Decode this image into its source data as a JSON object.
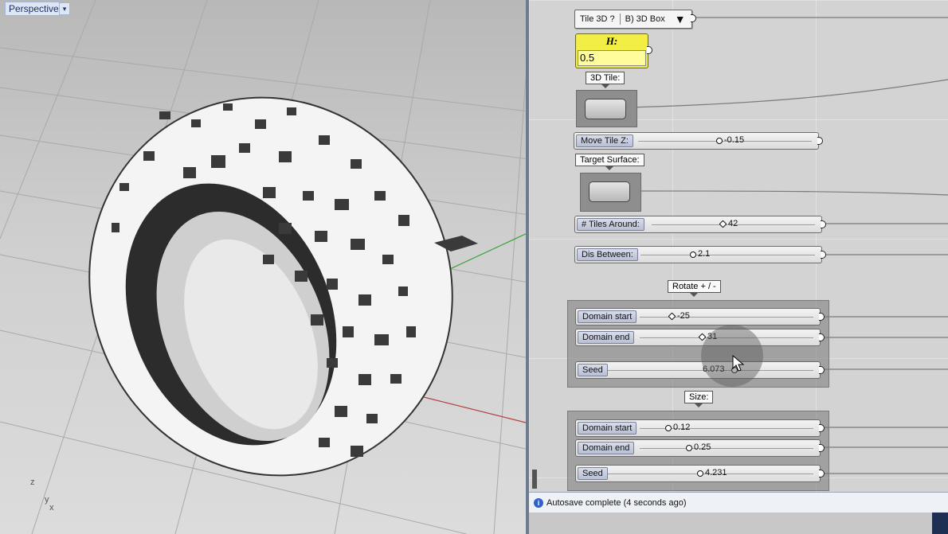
{
  "viewport": {
    "title": "Perspective",
    "menu_arrow": "▾",
    "axis": {
      "z": "z",
      "y": "y",
      "x": "x"
    }
  },
  "gh": {
    "tile_panel": {
      "label": "Tile 3D ?",
      "value": "B) 3D Box",
      "arrow": "▼"
    },
    "h_param": {
      "title": "H:",
      "value": "0.5"
    },
    "tile_param_label": "3D Tile:",
    "move_tile": {
      "label": "Move Tile Z:",
      "value": "-0.15"
    },
    "target_label": "Target Surface:",
    "tiles_around": {
      "label": "# Tiles Around:",
      "value": "42"
    },
    "dis_between": {
      "label": "Dis Between:",
      "value": "2.1"
    },
    "rotate_label": "Rotate + / -",
    "rotate": {
      "domain_start": {
        "label": "Domain start",
        "value": "-25"
      },
      "domain_end": {
        "label": "Domain end",
        "value": "31"
      },
      "seed": {
        "label": "Seed",
        "value": "6.073"
      }
    },
    "size_label": "Size:",
    "size": {
      "domain_start": {
        "label": "Domain start",
        "value": "0.12"
      },
      "domain_end": {
        "label": "Domain end",
        "value": "0.25"
      },
      "seed": {
        "label": "Seed",
        "value": "4.231"
      }
    }
  },
  "status": {
    "icon": "i",
    "text": "Autosave complete (4 seconds ago)"
  }
}
